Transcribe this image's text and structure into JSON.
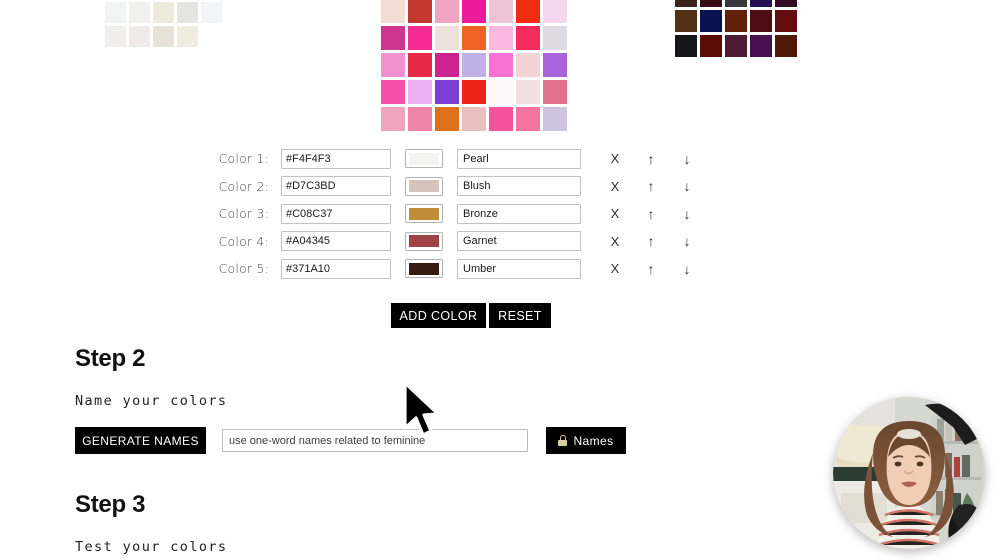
{
  "palettes": {
    "neutral": {
      "name": "neutral-palette-grid",
      "columns": 5,
      "swatches": [
        "#f2f2ee",
        "#eae8dc",
        "#dedacb",
        "#eceae6",
        "#ffffff",
        "#e9e6dc",
        "#f4f4f2",
        "#f1f1ef",
        "#e2e4e6",
        "#ffffff",
        "#f2f3f3",
        "#f0f0ee",
        "#eceadb",
        "#e4e4e2",
        "#f3f4f5",
        "#f0efec",
        "#efeae8",
        "#e7e1d8",
        "#eeecdf",
        "#ffffff"
      ]
    },
    "pink": {
      "name": "pink-palette-grid",
      "columns": 7,
      "swatches": [
        "#e8273c",
        "#ef8ba8",
        "#f3c0d0",
        "#d9355f",
        "#fbe3ef",
        "#8e4fd4",
        "#ef79a8",
        "#f4ddd5",
        "#c2372f",
        "#f0a4c4",
        "#ef1a9a",
        "#eec3d3",
        "#ef2b10",
        "#f4d6f0",
        "#cc3590",
        "#f72a93",
        "#eee0db",
        "#ef6323",
        "#fcb8e0",
        "#f72b60",
        "#dedae2",
        "#f291d0",
        "#e62949",
        "#cd2391",
        "#c0b0e4",
        "#f972d3",
        "#f4d3d6",
        "#a964dc",
        "#f551ab",
        "#eeb2f4",
        "#7a3fd3",
        "#ef2218",
        "#fdf7f9",
        "#f3dee1",
        "#e4718c",
        "#f0a4be",
        "#f083a8",
        "#e0711c",
        "#e9bfc0",
        "#f5549c",
        "#f3749f",
        "#cdc4e2"
      ]
    },
    "dark": {
      "name": "dark-palette-grid",
      "columns": 5,
      "swatches": [
        "#060608",
        "#200a1b",
        "#56200c",
        "#3c3d41",
        "#443c38",
        "#3b2419",
        "#380a13",
        "#36363b",
        "#261054",
        "#330b22",
        "#523117",
        "#0a1150",
        "#622108",
        "#4d0d12",
        "#650c10",
        "#161619",
        "#5a0d07",
        "#4e1b33",
        "#49104f",
        "#4e1a07"
      ]
    }
  },
  "color_rows": [
    {
      "label": "Color 1:",
      "hex": "#F4F4F3",
      "swatch": "#F4F4F3",
      "name": "Pearl"
    },
    {
      "label": "Color 2:",
      "hex": "#D7C3BD",
      "swatch": "#D7C3BD",
      "name": "Blush"
    },
    {
      "label": "Color 3:",
      "hex": "#C08C37",
      "swatch": "#C08C37",
      "name": "Bronze"
    },
    {
      "label": "Color 4:",
      "hex": "#A04345",
      "swatch": "#A04345",
      "name": "Garnet"
    },
    {
      "label": "Color 5:",
      "hex": "#371A10",
      "swatch": "#371A10",
      "name": "Umber"
    }
  ],
  "row_controls": {
    "remove": "X",
    "move_up": "↑",
    "move_down": "↓"
  },
  "actions": {
    "add_color": "ADD COLOR",
    "reset": "RESET"
  },
  "step2": {
    "title": "Step 2",
    "subtitle": "Name your colors",
    "generate_label": "GENERATE NAMES",
    "prompt_value": "use one-word names related to feminine",
    "lock_label": "Names"
  },
  "step3": {
    "title": "Step 3",
    "subtitle": "Test your colors"
  },
  "theme": {
    "accent": "#000000",
    "lock_gold": "#d8cf9a",
    "border": "#c2c2c2"
  }
}
